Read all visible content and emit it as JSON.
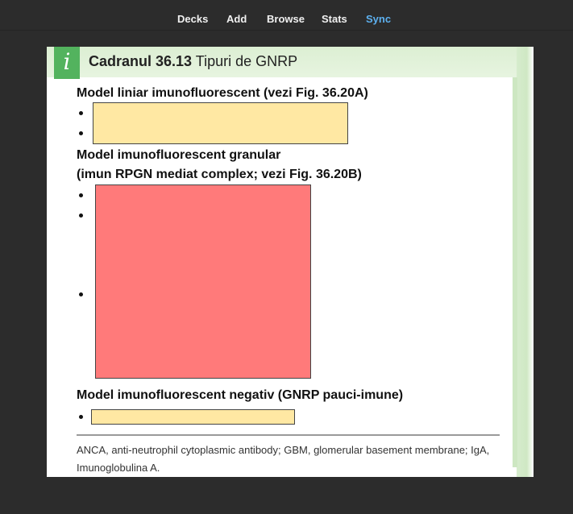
{
  "toolbar": {
    "items": [
      "Decks",
      "Add",
      "Browse",
      "Stats",
      "Sync"
    ],
    "active": "Sync",
    "active_color": "#5db1f0"
  },
  "card": {
    "badge_icon": "info-icon",
    "badge_glyph": "i",
    "title_bold": "Cadranul 36.13",
    "title_rest": " Tipuri de GNRP",
    "section1_heading": "Model liniar imunofluorescent (vezi Fig. 36.20A)",
    "section2_heading_line1": "Model imunofluorescent granular",
    "section2_heading_line2": "(imun RPGN mediat complex; vezi Fig. 36.20B)",
    "section3_heading": "Model imunofluorescent negativ (GNRP pauci-imune)",
    "footnote": "ANCA, anti-neutrophil cytoplasmic antibody; GBM, glomerular basement membrane; IgA, Imunoglobulina A.",
    "occlusion_colors": {
      "yellow": "#ffe8a3",
      "red": "#ff7a7a"
    }
  }
}
